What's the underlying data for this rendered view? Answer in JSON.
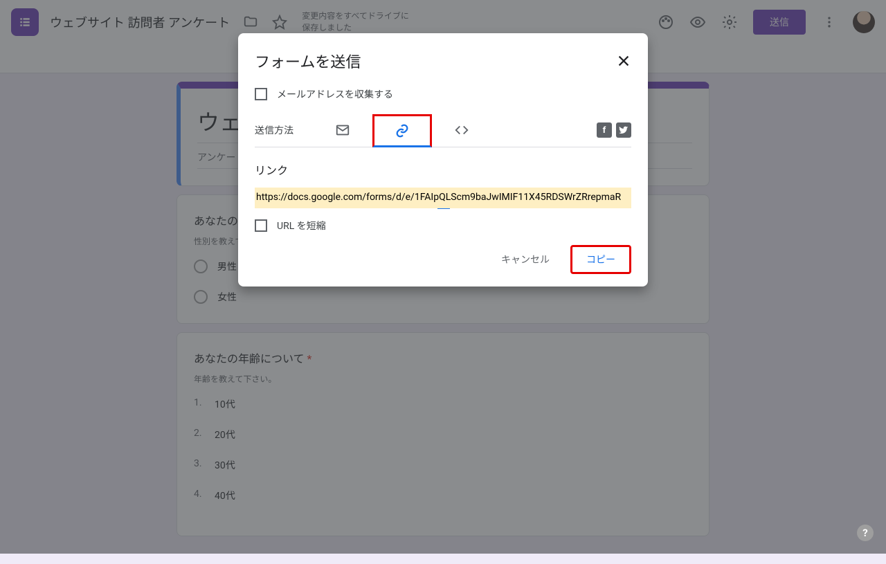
{
  "header": {
    "form_title": "ウェブサイト 訪問者 アンケート",
    "save_status_line1": "変更内容をすべてドライブに",
    "save_status_line2": "保存しました",
    "send_button": "送信"
  },
  "form": {
    "title": "ウェ",
    "description": "アンケート",
    "questions": [
      {
        "title": "あなたの",
        "description": "性別を教えて",
        "required": false,
        "type": "radio",
        "options": [
          "男性",
          "女性"
        ]
      },
      {
        "title": "あなたの年齢について",
        "description": "年齢を教えて下さい。",
        "required": true,
        "type": "list",
        "options": [
          "10代",
          "20代",
          "30代",
          "40代"
        ]
      }
    ]
  },
  "dialog": {
    "title": "フォームを送信",
    "collect_email_label": "メールアドレスを収集する",
    "method_label": "送信方法",
    "section_label": "リンク",
    "url": "https://docs.google.com/forms/d/e/1FAIpQLScm9baJwIMIF11X45RDSWrZRrepmaR",
    "shorten_label": "URL を短縮",
    "cancel": "キャンセル",
    "copy": "コピー"
  },
  "icons": {
    "folder": "folder-icon",
    "star": "star-icon",
    "palette": "palette-icon",
    "preview": "eye-icon",
    "settings": "gear-icon",
    "more": "more-icon"
  }
}
